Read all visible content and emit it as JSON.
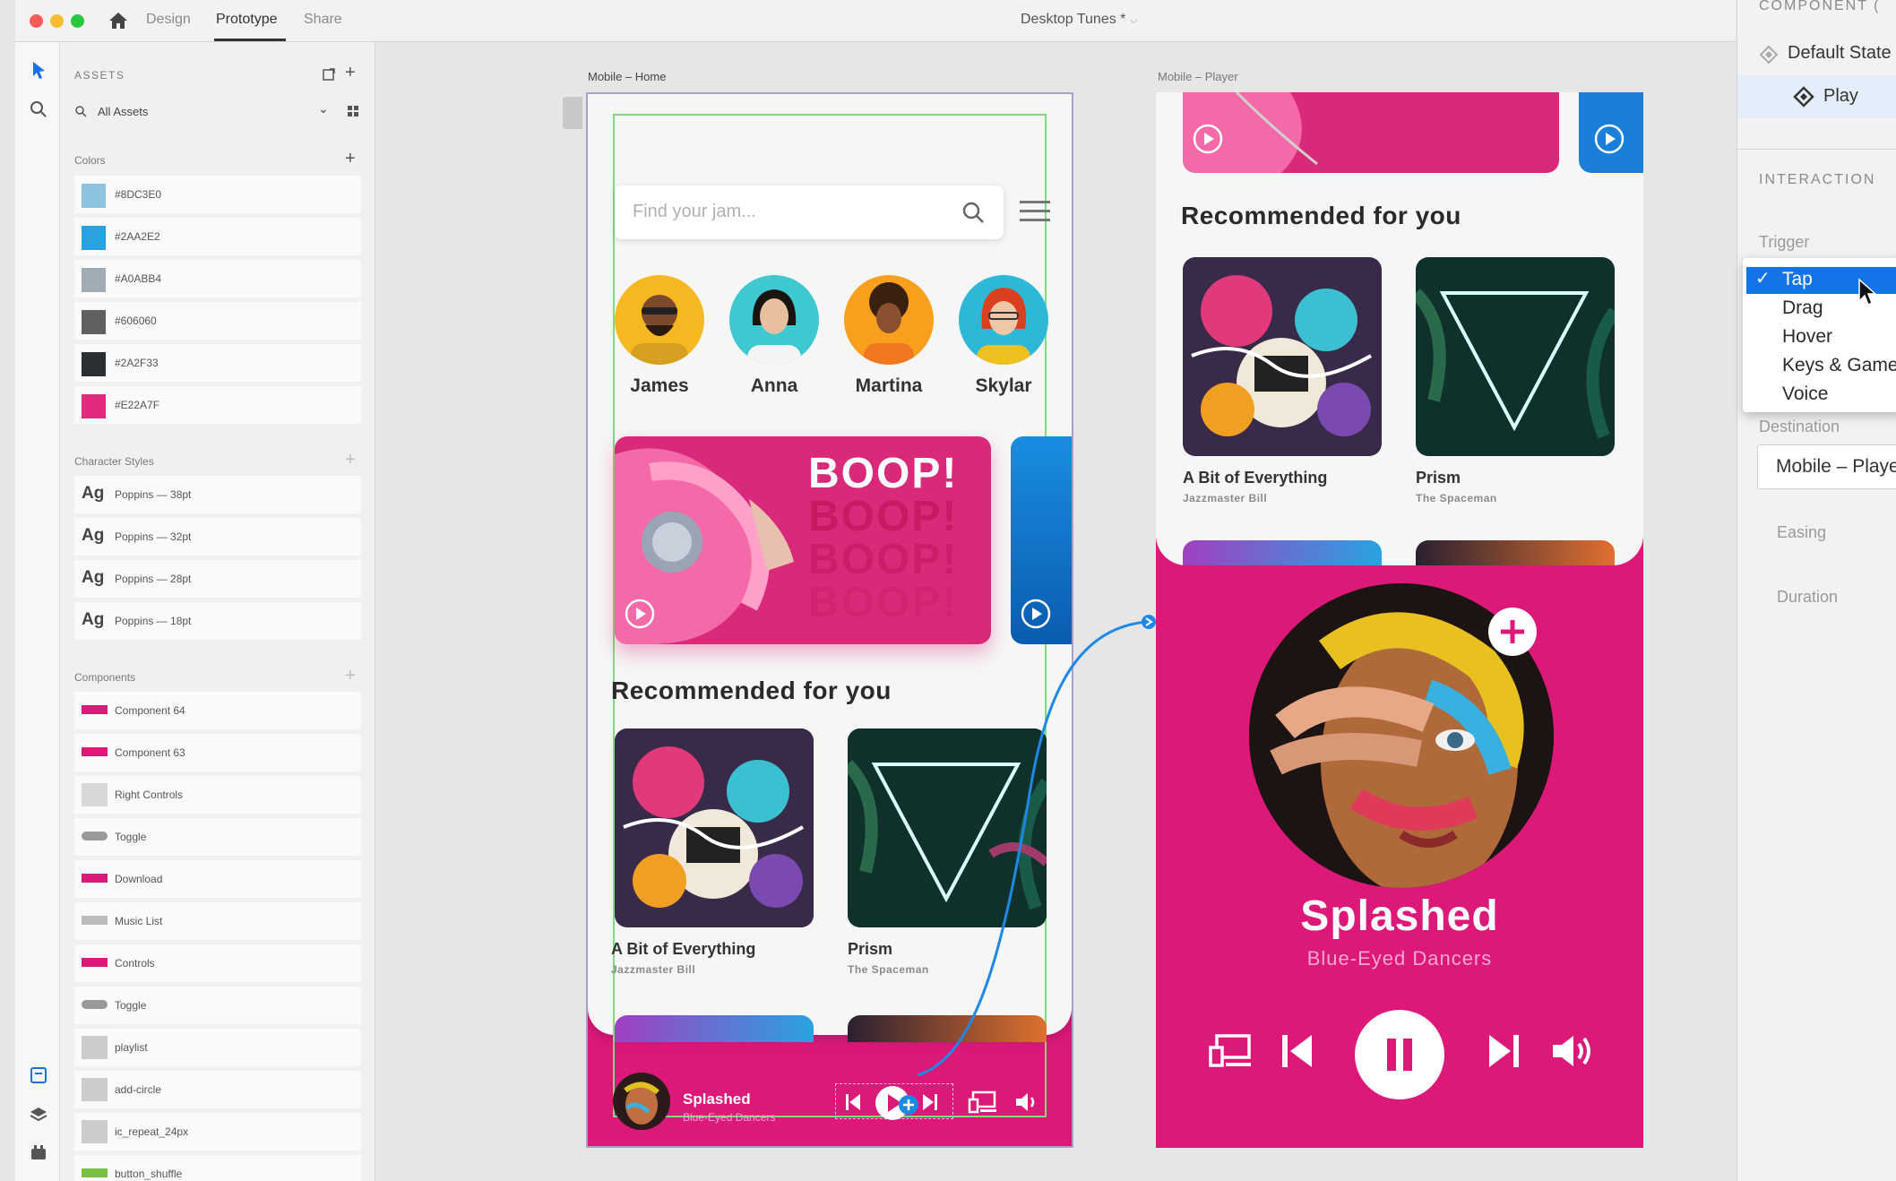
{
  "window": {
    "tabs": [
      "Design",
      "Prototype",
      "Share"
    ],
    "active_tab": "Prototype",
    "doc_title": "Desktop Tunes *"
  },
  "assets": {
    "header": "ASSETS",
    "filter": "All Assets",
    "colors_label": "Colors",
    "colors": [
      {
        "hex": "#8DC3E0",
        "swatch": "#8dc3e0"
      },
      {
        "hex": "#2AA2E2",
        "swatch": "#2aa2e2"
      },
      {
        "hex": "#A0ABB4",
        "swatch": "#a0abb4"
      },
      {
        "hex": "#606060",
        "swatch": "#606060"
      },
      {
        "hex": "#2A2F33",
        "swatch": "#2a2f33"
      },
      {
        "hex": "#E22A7F",
        "swatch": "#e22a7f"
      }
    ],
    "char_styles_label": "Character Styles",
    "char_styles": [
      "Poppins — 38pt",
      "Poppins — 32pt",
      "Poppins — 28pt",
      "Poppins — 18pt"
    ],
    "ag": "Ag",
    "components_label": "Components",
    "components": [
      "Component 64",
      "Component 63",
      "Right Controls",
      "Toggle",
      "Download",
      "Music List",
      "Controls",
      "Toggle",
      "playlist",
      "add-circle",
      "ic_repeat_24px",
      "button_shuffle"
    ]
  },
  "home": {
    "label": "Mobile – Home",
    "search_placeholder": "Find your jam...",
    "people": [
      "James",
      "Anna",
      "Martina",
      "Skylar"
    ],
    "banner_text": "BOOP!",
    "recommended": "Recommended for you",
    "albums": [
      {
        "title": "A Bit of Everything",
        "artist": "Jazzmaster Bill"
      },
      {
        "title": "Prism",
        "artist": "The Spaceman"
      }
    ],
    "now_playing": {
      "title": "Splashed",
      "artist": "Blue-Eyed Dancers"
    }
  },
  "player": {
    "label": "Mobile – Player",
    "recommended": "Recommended for you",
    "albums": [
      {
        "title": "A Bit of Everything",
        "artist": "Jazzmaster Bill"
      },
      {
        "title": "Prism",
        "artist": "The Spaceman"
      }
    ],
    "track_title": "Splashed",
    "track_artist": "Blue-Eyed Dancers"
  },
  "inspector": {
    "component_header": "COMPONENT (",
    "default_state": "Default State",
    "play_state": "Play",
    "interaction_header": "INTERACTION",
    "trigger_label": "Trigger",
    "triggers": [
      "Tap",
      "Drag",
      "Hover",
      "Keys & Gamepad",
      "Voice"
    ],
    "selected_trigger": "Tap",
    "destination_label": "Destination",
    "destination_value": "Mobile – Player",
    "easing_label": "Easing",
    "duration_label": "Duration"
  }
}
